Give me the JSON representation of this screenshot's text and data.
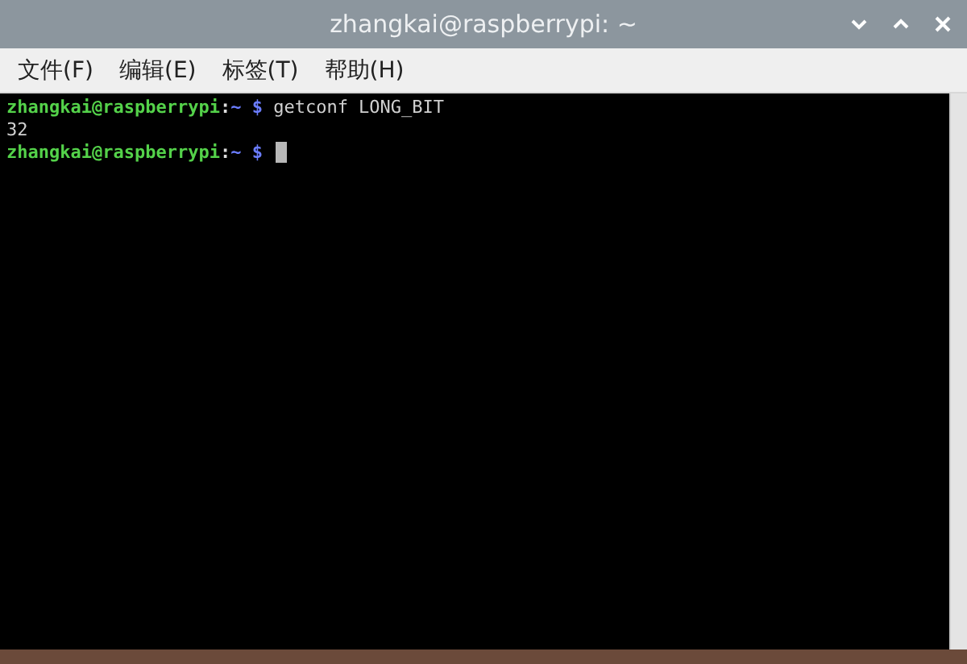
{
  "window": {
    "title": "zhangkai@raspberrypi: ~"
  },
  "menu": [
    {
      "label": "文件(F)"
    },
    {
      "label": "编辑(E)"
    },
    {
      "label": "标签(T)"
    },
    {
      "label": "帮助(H)"
    }
  ],
  "terminal": {
    "lines": [
      {
        "kind": "prompt",
        "user_host": "zhangkai@raspberrypi",
        "separator": ":",
        "path": "~",
        "symbol": "$",
        "command": "getconf LONG_BIT",
        "cursor": false
      },
      {
        "kind": "output",
        "text": "32"
      },
      {
        "kind": "prompt",
        "user_host": "zhangkai@raspberrypi",
        "separator": ":",
        "path": "~",
        "symbol": "$",
        "cursor": true
      }
    ]
  }
}
